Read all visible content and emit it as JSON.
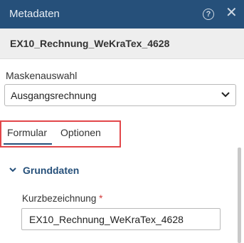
{
  "window": {
    "title": "Metadaten",
    "help_icon": "help-circle-icon",
    "help_glyph": "?",
    "close_icon": "close-icon",
    "close_glyph": "✕"
  },
  "document": {
    "name": "EX10_Rechnung_WeKraTex_4628"
  },
  "mask_selection": {
    "label": "Maskenauswahl",
    "selected": "Ausgangsrechnung",
    "dropdown_icon": "chevron-down-icon"
  },
  "tabs": [
    {
      "label": "Formular",
      "active": true
    },
    {
      "label": "Optionen",
      "active": false
    }
  ],
  "colors": {
    "header_bg": "#26507a",
    "highlight_border": "#e2474a",
    "required_marker": "#d23c3c"
  },
  "form": {
    "section": {
      "title": "Grunddaten",
      "expanded": true,
      "toggle_icon": "chevron-down-icon"
    },
    "fields": [
      {
        "label": "Kurzbezeichnung",
        "required_marker": "*",
        "value": "EX10_Rechnung_WeKraTex_4628"
      }
    ]
  }
}
